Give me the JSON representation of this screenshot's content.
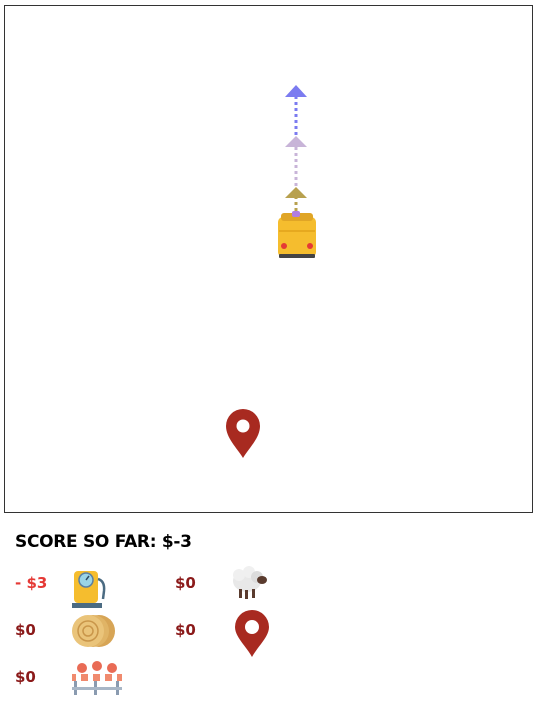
{
  "score": {
    "title": "SCORE SO FAR: $-3"
  },
  "legend": {
    "fuel": {
      "value": "- $3",
      "icon": "fuel-pump-icon",
      "color": "#e53935"
    },
    "sheep": {
      "value": "$0",
      "icon": "sheep-icon",
      "color": "#8b1a1a"
    },
    "hay": {
      "value": "$0",
      "icon": "hay-bale-icon",
      "color": "#8b1a1a"
    },
    "destination": {
      "value": "$0",
      "icon": "location-pin-icon",
      "color": "#8b1a1a"
    },
    "roadblock": {
      "value": "$0",
      "icon": "roadblock-icon",
      "color": "#8b1a1a"
    }
  },
  "board": {
    "vehicle": "truck-icon",
    "destination": "location-pin-icon",
    "path_colors": [
      "#b8a14f",
      "#c8b4d8",
      "#7b7bf0"
    ]
  }
}
